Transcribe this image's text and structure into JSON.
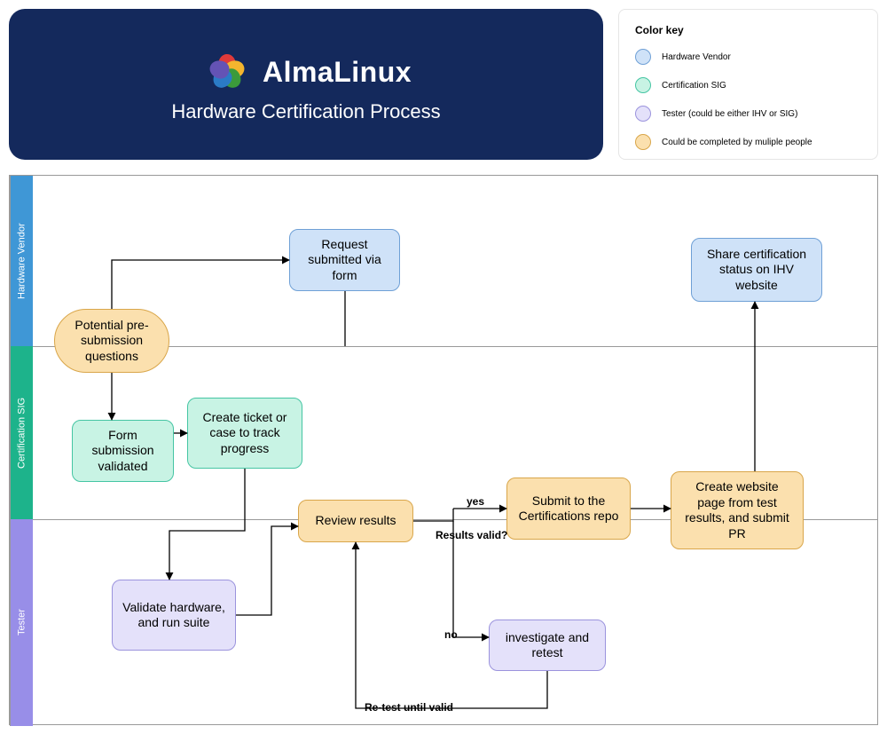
{
  "header": {
    "title": "AlmaLinux",
    "subtitle": "Hardware Certification Process"
  },
  "legend": {
    "title": "Color key",
    "items": [
      {
        "label": "Hardware Vendor",
        "swatch": "blue"
      },
      {
        "label": "Certification SIG",
        "swatch": "green"
      },
      {
        "label": "Tester (could be either IHV or SIG)",
        "swatch": "purple"
      },
      {
        "label": "Could be completed by muliple people",
        "swatch": "orange"
      }
    ]
  },
  "lanes": {
    "hv": "Hardware Vendor",
    "sig": "Certification SIG",
    "tester": "Tester"
  },
  "nodes": {
    "pre_questions": "Potential pre-submission questions",
    "request_form": "Request submitted via form",
    "form_validated": "Form submission validated",
    "create_ticket": "Create ticket or case to track progress",
    "validate_hw": "Validate hardware, and run suite",
    "review_results": "Review results",
    "investigate": "investigate and retest",
    "submit_repo": "Submit to the Certifications repo",
    "create_website": "Create website page from test results, and submit PR",
    "share_status": "Share certification status on IHV website"
  },
  "edges": {
    "results_valid": "Results valid?",
    "yes": "yes",
    "no": "no",
    "retest": "Re-test until valid"
  },
  "colors": {
    "blue": "#cfe2f8",
    "green": "#c8f3e4",
    "purple": "#e4e1fa",
    "orange": "#fbe0ae",
    "navy": "#14295c"
  }
}
